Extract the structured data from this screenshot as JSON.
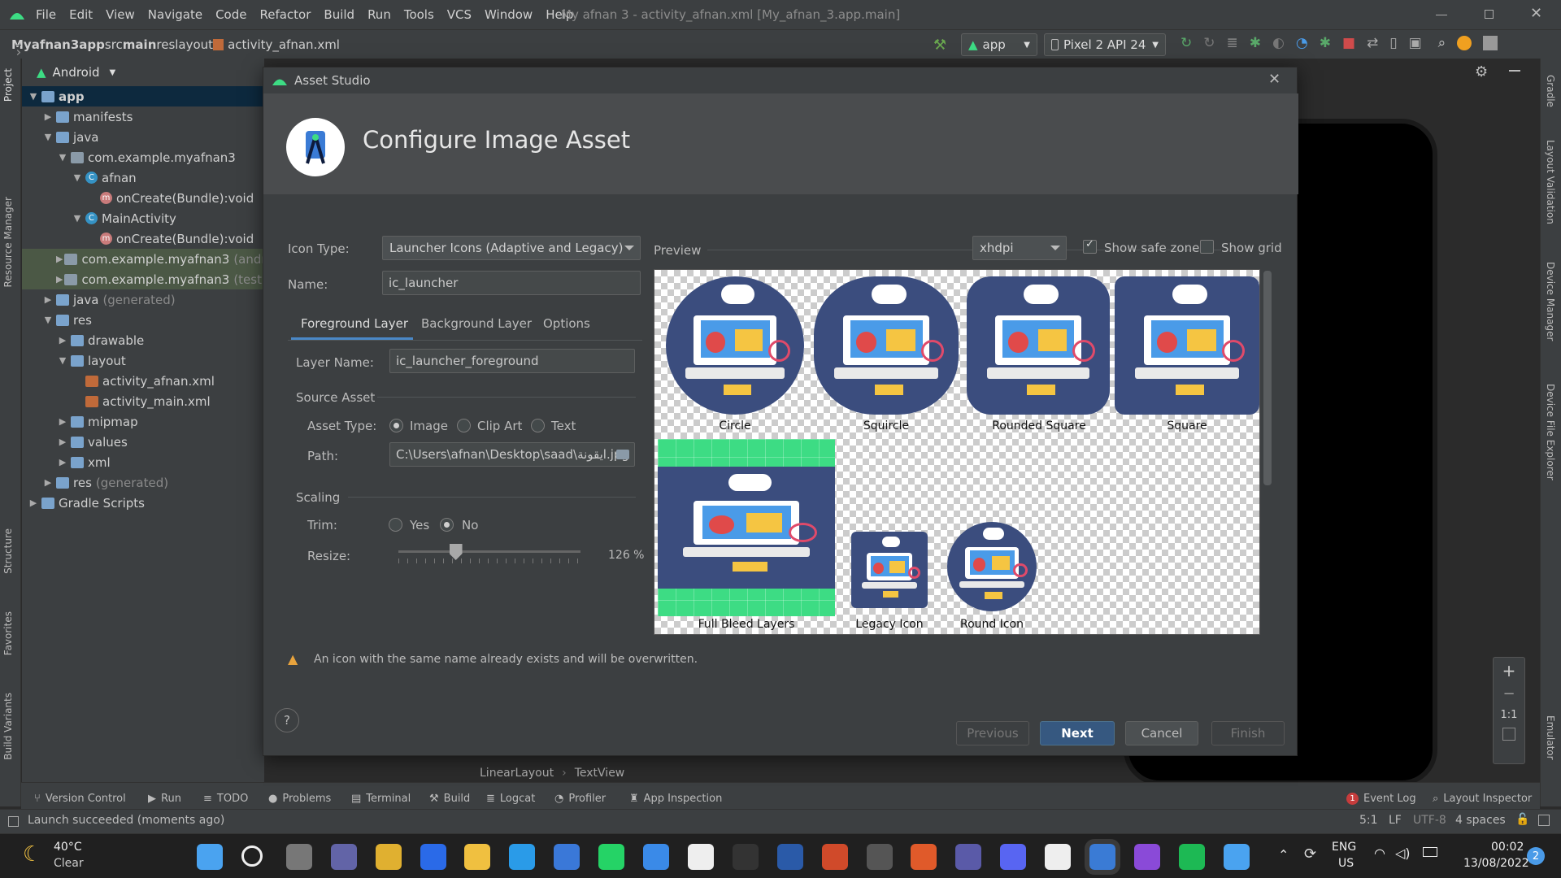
{
  "window": {
    "menu": [
      "File",
      "Edit",
      "View",
      "Navigate",
      "Code",
      "Refactor",
      "Build",
      "Run",
      "Tools",
      "VCS",
      "Window",
      "Help"
    ],
    "title": "My afnan 3 - activity_afnan.xml [My_afnan_3.app.main]"
  },
  "breadcrumb": [
    "Myafnan3",
    "app",
    "src",
    "main",
    "res",
    "layout",
    "activity_afnan.xml"
  ],
  "toolbar": {
    "run_config": "app",
    "device": "Pixel 2 API 24"
  },
  "left_tabs": [
    "Project",
    "Resource Manager",
    "Structure",
    "Favorites",
    "Build Variants"
  ],
  "right_tabs": [
    "Gradle",
    "Layout Validation",
    "Device Manager",
    "Device File Explorer",
    "Emulator"
  ],
  "project": {
    "view": "Android",
    "tree": [
      {
        "label": "app",
        "level": 0,
        "icon": "folder",
        "open": true
      },
      {
        "label": "manifests",
        "level": 1,
        "icon": "folder"
      },
      {
        "label": "java",
        "level": 1,
        "icon": "folder",
        "open": true
      },
      {
        "label": "com.example.myafnan3",
        "level": 2,
        "icon": "pkg",
        "open": true
      },
      {
        "label": "afnan",
        "level": 3,
        "icon": "class",
        "open": true
      },
      {
        "label": "onCreate(Bundle):void",
        "level": 4,
        "icon": "method"
      },
      {
        "label": "MainActivity",
        "level": 3,
        "icon": "class",
        "open": true
      },
      {
        "label": "onCreate(Bundle):void",
        "level": 4,
        "icon": "method"
      },
      {
        "label": "com.example.myafnan3",
        "suffix": "(andr",
        "level": 2,
        "icon": "pkg"
      },
      {
        "label": "com.example.myafnan3",
        "suffix": "(test)",
        "level": 2,
        "icon": "pkg"
      },
      {
        "label": "java",
        "suffix": "(generated)",
        "level": 1,
        "icon": "folder"
      },
      {
        "label": "res",
        "level": 1,
        "icon": "folder",
        "open": true
      },
      {
        "label": "drawable",
        "level": 2,
        "icon": "folder"
      },
      {
        "label": "layout",
        "level": 2,
        "icon": "folder",
        "open": true
      },
      {
        "label": "activity_afnan.xml",
        "level": 3,
        "icon": "xml"
      },
      {
        "label": "activity_main.xml",
        "level": 3,
        "icon": "xml"
      },
      {
        "label": "mipmap",
        "level": 2,
        "icon": "folder"
      },
      {
        "label": "values",
        "level": 2,
        "icon": "folder"
      },
      {
        "label": "xml",
        "level": 2,
        "icon": "folder"
      },
      {
        "label": "res",
        "suffix": "(generated)",
        "level": 1,
        "icon": "folder"
      },
      {
        "label": "Gradle Scripts",
        "level": 0,
        "icon": "gradle"
      }
    ]
  },
  "dialog": {
    "title": "Asset Studio",
    "heading": "Configure Image Asset",
    "icon_type_label": "Icon Type:",
    "icon_type": "Launcher Icons (Adaptive and Legacy)",
    "name_label": "Name:",
    "name": "ic_launcher",
    "tabs": [
      "Foreground Layer",
      "Background Layer",
      "Options"
    ],
    "layer_name_label": "Layer Name:",
    "layer_name": "ic_launcher_foreground",
    "source_asset": "Source Asset",
    "asset_type_label": "Asset Type:",
    "asset_types": [
      "Image",
      "Clip Art",
      "Text"
    ],
    "path_label": "Path:",
    "path": "C:\\Users\\afnan\\Desktop\\saad\\ايقونة.jpg",
    "scaling": "Scaling",
    "trim_label": "Trim:",
    "trim_options": [
      "Yes",
      "No"
    ],
    "resize_label": "Resize:",
    "resize": "126 %",
    "resize_value": 126,
    "preview_label": "Preview",
    "density": "xhdpi",
    "show_safe_zone": "Show safe zone",
    "show_grid": "Show grid",
    "previews": [
      "Circle",
      "Squircle",
      "Rounded Square",
      "Square",
      "Full Bleed Layers",
      "Legacy Icon",
      "Round Icon"
    ],
    "warning": "An icon with the same name already exists and will be overwritten.",
    "buttons": {
      "help": "?",
      "previous": "Previous",
      "next": "Next",
      "cancel": "Cancel",
      "finish": "Finish"
    }
  },
  "editor": {
    "crumb": [
      "LinearLayout",
      "TextView"
    ]
  },
  "bottom_tabs": [
    "Version Control",
    "Run",
    "TODO",
    "Problems",
    "Terminal",
    "Build",
    "Logcat",
    "Profiler",
    "App Inspection"
  ],
  "bottom_right": [
    "Event Log",
    "Layout Inspector"
  ],
  "event_count": "1",
  "status": {
    "message": "Launch succeeded (moments ago)",
    "pos": "5:1",
    "lf": "LF",
    "enc": "UTF-8",
    "indent": "4 spaces"
  },
  "zoom": [
    "+",
    "−",
    "1:1"
  ],
  "taskbar": {
    "temp": "40°C",
    "weather": "Clear",
    "lang": "ENG",
    "region": "US",
    "time": "00:02",
    "date": "13/08/2022",
    "notif": "2"
  },
  "colors": {
    "accent": "#365880",
    "android_green": "#3ddc84",
    "icon_blue": "#3b4d7e"
  }
}
